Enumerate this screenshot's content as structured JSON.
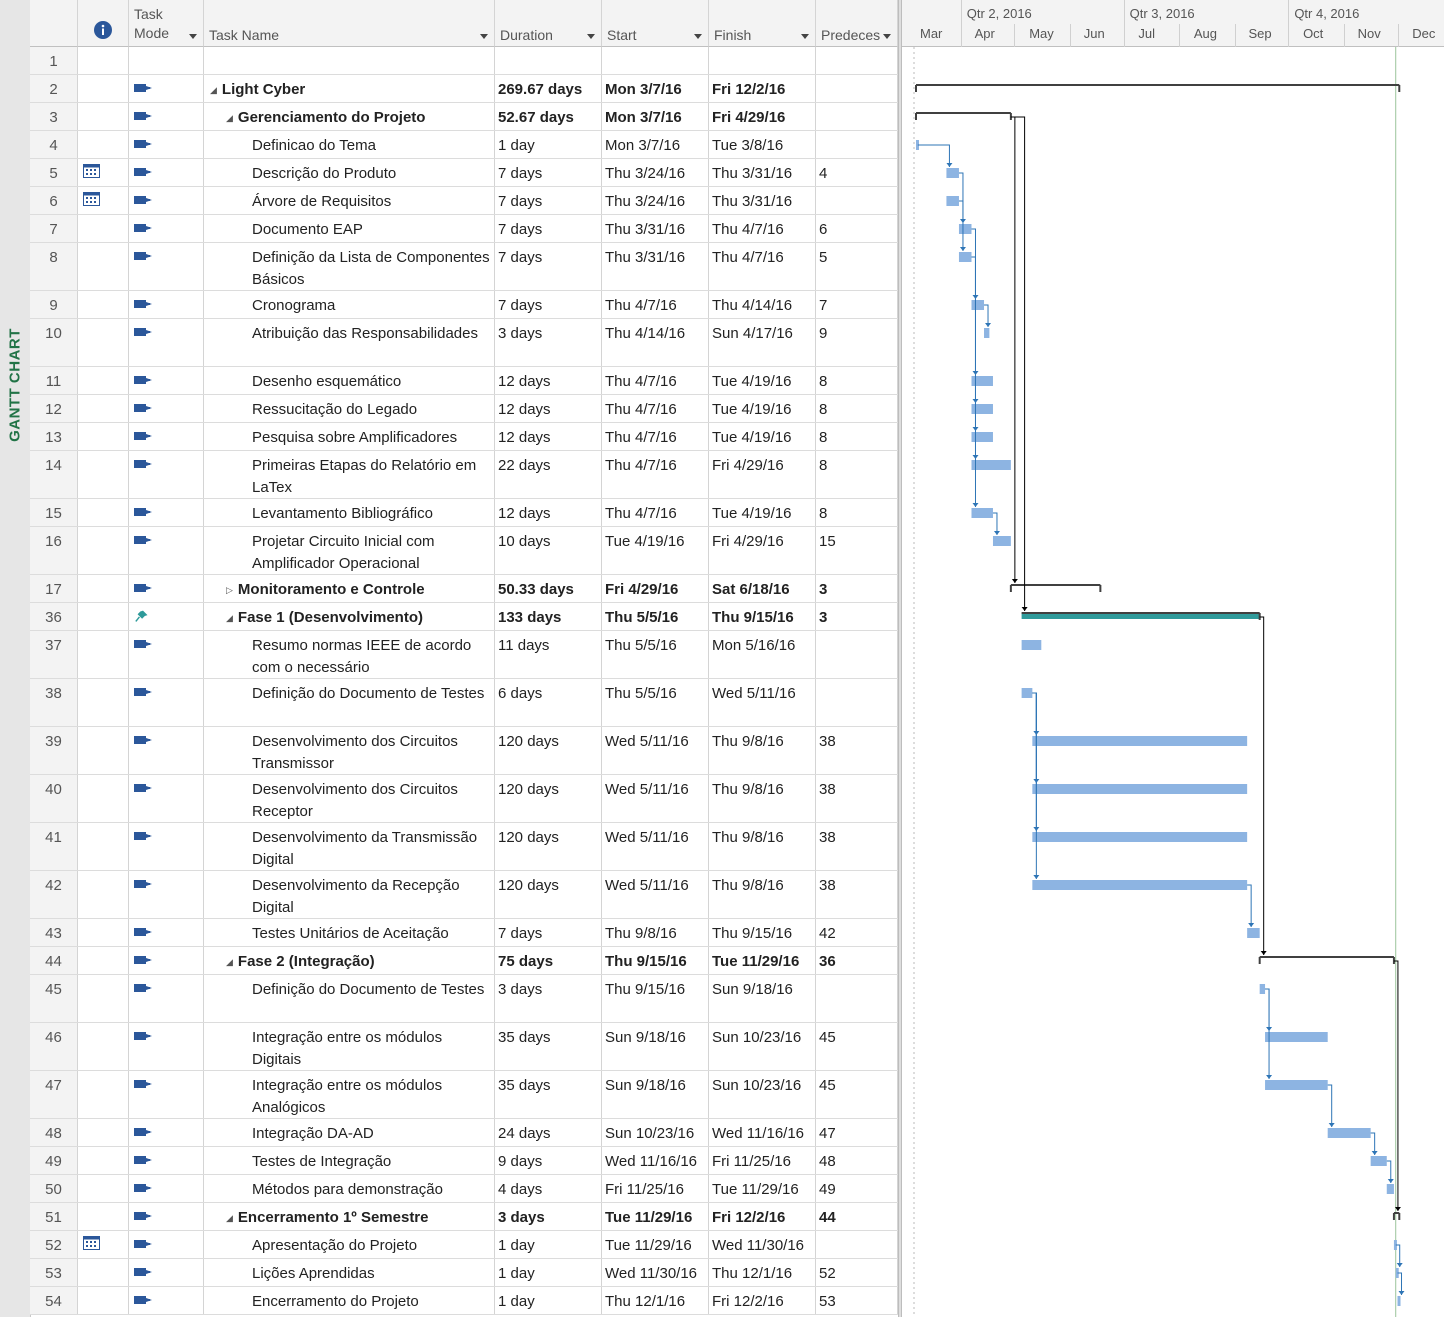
{
  "view": {
    "label": "GANTT CHART"
  },
  "columns": {
    "info_icon": "info-icon",
    "task_mode": "Task Mode",
    "task_name": "Task Name",
    "duration": "Duration",
    "start": "Start",
    "finish": "Finish",
    "predecessors": "Predeces"
  },
  "timescale": {
    "quarters": [
      "Qtr 2, 2016",
      "Qtr 3, 2016",
      "Qtr 4, 2016"
    ],
    "months": [
      "Mar",
      "Apr",
      "May",
      "Jun",
      "Jul",
      "Aug",
      "Sep",
      "Oct",
      "Nov",
      "Dec"
    ]
  },
  "colors": {
    "task_bar": "#8db4e2",
    "manual_summary_bar": "#2f9a9a",
    "summary_bracket": "#404040",
    "link_arrow": "#2e75b6",
    "accent_label": "#217346"
  },
  "tasks": [
    {
      "id": "1",
      "mode": "",
      "name": "",
      "duration": "",
      "start": "",
      "finish": "",
      "pred": "",
      "level": 0,
      "summary": false,
      "lines": 1
    },
    {
      "id": "2",
      "mode": "auto",
      "name": "Light Cyber",
      "duration": "269.67 days",
      "start": "Mon 3/7/16",
      "finish": "Fri 12/2/16",
      "pred": "",
      "level": 0,
      "summary": true,
      "expanded": true,
      "lines": 1
    },
    {
      "id": "3",
      "mode": "auto",
      "name": "Gerenciamento do Projeto",
      "duration": "52.67 days",
      "start": "Mon 3/7/16",
      "finish": "Fri 4/29/16",
      "pred": "",
      "level": 1,
      "summary": true,
      "expanded": true,
      "lines": 1
    },
    {
      "id": "4",
      "mode": "auto",
      "name": "Definicao do Tema",
      "duration": "1 day",
      "start": "Mon 3/7/16",
      "finish": "Tue 3/8/16",
      "pred": "",
      "level": 2,
      "summary": false,
      "lines": 1
    },
    {
      "id": "5",
      "mode": "auto",
      "calendar": true,
      "name": "Descrição do Produto",
      "duration": "7 days",
      "start": "Thu 3/24/16",
      "finish": "Thu 3/31/16",
      "pred": "4",
      "level": 2,
      "summary": false,
      "lines": 1
    },
    {
      "id": "6",
      "mode": "auto",
      "calendar": true,
      "name": "Árvore de Requisitos",
      "duration": "7 days",
      "start": "Thu 3/24/16",
      "finish": "Thu 3/31/16",
      "pred": "",
      "level": 2,
      "summary": false,
      "lines": 1
    },
    {
      "id": "7",
      "mode": "auto",
      "name": "Documento EAP",
      "duration": "7 days",
      "start": "Thu 3/31/16",
      "finish": "Thu 4/7/16",
      "pred": "6",
      "level": 2,
      "summary": false,
      "lines": 1
    },
    {
      "id": "8",
      "mode": "auto",
      "name": "Definição da Lista de Componentes Básicos",
      "duration": "7 days",
      "start": "Thu 3/31/16",
      "finish": "Thu 4/7/16",
      "pred": "5",
      "level": 2,
      "summary": false,
      "lines": 2
    },
    {
      "id": "9",
      "mode": "auto",
      "name": "Cronograma",
      "duration": "7 days",
      "start": "Thu 4/7/16",
      "finish": "Thu 4/14/16",
      "pred": "7",
      "level": 2,
      "summary": false,
      "lines": 1
    },
    {
      "id": "10",
      "mode": "auto",
      "name": "Atribuição das Responsabilidades",
      "duration": "3 days",
      "start": "Thu 4/14/16",
      "finish": "Sun 4/17/16",
      "pred": "9",
      "level": 2,
      "summary": false,
      "lines": 2
    },
    {
      "id": "11",
      "mode": "auto",
      "name": "Desenho esquemático",
      "duration": "12 days",
      "start": "Thu 4/7/16",
      "finish": "Tue 4/19/16",
      "pred": "8",
      "level": 2,
      "summary": false,
      "lines": 1
    },
    {
      "id": "12",
      "mode": "auto",
      "name": "Ressucitação do Legado",
      "duration": "12 days",
      "start": "Thu 4/7/16",
      "finish": "Tue 4/19/16",
      "pred": "8",
      "level": 2,
      "summary": false,
      "lines": 1
    },
    {
      "id": "13",
      "mode": "auto",
      "name": "Pesquisa sobre Amplificadores",
      "duration": "12 days",
      "start": "Thu 4/7/16",
      "finish": "Tue 4/19/16",
      "pred": "8",
      "level": 2,
      "summary": false,
      "lines": 1
    },
    {
      "id": "14",
      "mode": "auto",
      "name": "Primeiras Etapas do Relatório em LaTex",
      "duration": "22 days",
      "start": "Thu 4/7/16",
      "finish": "Fri 4/29/16",
      "pred": "8",
      "level": 2,
      "summary": false,
      "lines": 2
    },
    {
      "id": "15",
      "mode": "auto",
      "name": "Levantamento Bibliográfico",
      "duration": "12 days",
      "start": "Thu 4/7/16",
      "finish": "Tue 4/19/16",
      "pred": "8",
      "level": 2,
      "summary": false,
      "lines": 1
    },
    {
      "id": "16",
      "mode": "auto",
      "name": "Projetar Circuito Inicial com Amplificador Operacional",
      "duration": "10 days",
      "start": "Tue 4/19/16",
      "finish": "Fri 4/29/16",
      "pred": "15",
      "level": 2,
      "summary": false,
      "lines": 2
    },
    {
      "id": "17",
      "mode": "auto",
      "name": "Monitoramento e Controle",
      "duration": "50.33 days",
      "start": "Fri 4/29/16",
      "finish": "Sat 6/18/16",
      "pred": "3",
      "level": 1,
      "summary": true,
      "expanded": false,
      "lines": 1
    },
    {
      "id": "36",
      "mode": "manual",
      "name": "Fase 1 (Desenvolvimento)",
      "duration": "133 days",
      "start": "Thu 5/5/16",
      "finish": "Thu 9/15/16",
      "pred": "3",
      "level": 1,
      "summary": true,
      "expanded": true,
      "lines": 1
    },
    {
      "id": "37",
      "mode": "auto",
      "name": "Resumo normas IEEE de acordo com o necessário",
      "duration": "11 days",
      "start": "Thu 5/5/16",
      "finish": "Mon 5/16/16",
      "pred": "",
      "level": 2,
      "summary": false,
      "lines": 2
    },
    {
      "id": "38",
      "mode": "auto",
      "name": "Definição do Documento de Testes",
      "duration": "6 days",
      "start": "Thu 5/5/16",
      "finish": "Wed 5/11/16",
      "pred": "",
      "level": 2,
      "summary": false,
      "lines": 2
    },
    {
      "id": "39",
      "mode": "auto",
      "name": "Desenvolvimento dos Circuitos Transmissor",
      "duration": "120 days",
      "start": "Wed 5/11/16",
      "finish": "Thu 9/8/16",
      "pred": "38",
      "level": 2,
      "summary": false,
      "lines": 2
    },
    {
      "id": "40",
      "mode": "auto",
      "name": "Desenvolvimento dos Circuitos Receptor",
      "duration": "120 days",
      "start": "Wed 5/11/16",
      "finish": "Thu 9/8/16",
      "pred": "38",
      "level": 2,
      "summary": false,
      "lines": 2
    },
    {
      "id": "41",
      "mode": "auto",
      "name": "Desenvolvimento da Transmissão Digital",
      "duration": "120 days",
      "start": "Wed 5/11/16",
      "finish": "Thu 9/8/16",
      "pred": "38",
      "level": 2,
      "summary": false,
      "lines": 2
    },
    {
      "id": "42",
      "mode": "auto",
      "name": "Desenvolvimento da Recepção Digital",
      "duration": "120 days",
      "start": "Wed 5/11/16",
      "finish": "Thu 9/8/16",
      "pred": "38",
      "level": 2,
      "summary": false,
      "lines": 2
    },
    {
      "id": "43",
      "mode": "auto",
      "name": "Testes Unitários de Aceitação",
      "duration": "7 days",
      "start": "Thu 9/8/16",
      "finish": "Thu 9/15/16",
      "pred": "42",
      "level": 2,
      "summary": false,
      "lines": 1
    },
    {
      "id": "44",
      "mode": "auto",
      "name": "Fase 2 (Integração)",
      "duration": "75 days",
      "start": "Thu 9/15/16",
      "finish": "Tue 11/29/16",
      "pred": "36",
      "level": 1,
      "summary": true,
      "expanded": true,
      "lines": 1
    },
    {
      "id": "45",
      "mode": "auto",
      "name": "Definição do Documento de Testes",
      "duration": "3 days",
      "start": "Thu 9/15/16",
      "finish": "Sun 9/18/16",
      "pred": "",
      "level": 2,
      "summary": false,
      "lines": 2
    },
    {
      "id": "46",
      "mode": "auto",
      "name": "Integração entre os módulos Digitais",
      "duration": "35 days",
      "start": "Sun 9/18/16",
      "finish": "Sun 10/23/16",
      "pred": "45",
      "level": 2,
      "summary": false,
      "lines": 2
    },
    {
      "id": "47",
      "mode": "auto",
      "name": "Integração entre os módulos Analógicos",
      "duration": "35 days",
      "start": "Sun 9/18/16",
      "finish": "Sun 10/23/16",
      "pred": "45",
      "level": 2,
      "summary": false,
      "lines": 2
    },
    {
      "id": "48",
      "mode": "auto",
      "name": "Integração DA-AD",
      "duration": "24 days",
      "start": "Sun 10/23/16",
      "finish": "Wed 11/16/16",
      "pred": "47",
      "level": 2,
      "summary": false,
      "lines": 1
    },
    {
      "id": "49",
      "mode": "auto",
      "name": "Testes de Integração",
      "duration": "9 days",
      "start": "Wed 11/16/16",
      "finish": "Fri 11/25/16",
      "pred": "48",
      "level": 2,
      "summary": false,
      "lines": 1
    },
    {
      "id": "50",
      "mode": "auto",
      "name": "Métodos para demonstração",
      "duration": "4 days",
      "start": "Fri 11/25/16",
      "finish": "Tue 11/29/16",
      "pred": "49",
      "level": 2,
      "summary": false,
      "lines": 1
    },
    {
      "id": "51",
      "mode": "auto",
      "name": "Encerramento 1º Semestre",
      "duration": "3 days",
      "start": "Tue 11/29/16",
      "finish": "Fri 12/2/16",
      "pred": "44",
      "level": 1,
      "summary": true,
      "expanded": true,
      "lines": 1
    },
    {
      "id": "52",
      "mode": "auto",
      "calendar": true,
      "name": "Apresentação do Projeto",
      "duration": "1 day",
      "start": "Tue 11/29/16",
      "finish": "Wed 11/30/16",
      "pred": "",
      "level": 2,
      "summary": false,
      "lines": 1
    },
    {
      "id": "53",
      "mode": "auto",
      "name": "Lições Aprendidas",
      "duration": "1 day",
      "start": "Wed 11/30/16",
      "finish": "Thu 12/1/16",
      "pred": "52",
      "level": 2,
      "summary": false,
      "lines": 1
    },
    {
      "id": "54",
      "mode": "auto",
      "name": "Encerramento do Projeto",
      "duration": "1 day",
      "start": "Thu 12/1/16",
      "finish": "Fri 12/2/16",
      "pred": "53",
      "level": 2,
      "summary": false,
      "lines": 1
    }
  ]
}
